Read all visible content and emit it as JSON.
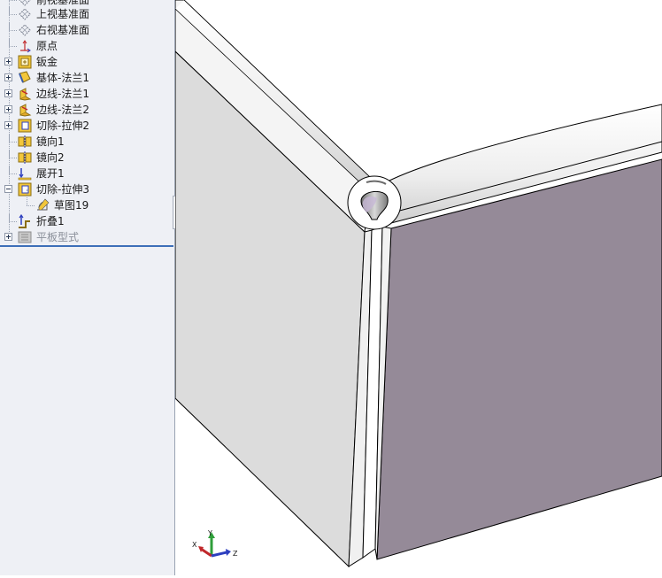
{
  "feature_tree": {
    "items": [
      {
        "label": "前视基准面",
        "icon": "plane-icon"
      },
      {
        "label": "上视基准面",
        "icon": "plane-icon"
      },
      {
        "label": "右视基准面",
        "icon": "plane-icon"
      },
      {
        "label": "原点",
        "icon": "origin-icon"
      },
      {
        "label": "钣金",
        "icon": "sheet-metal-icon"
      },
      {
        "label": "基体-法兰1",
        "icon": "base-flange-icon"
      },
      {
        "label": "边线-法兰1",
        "icon": "edge-flange-icon"
      },
      {
        "label": "边线-法兰2",
        "icon": "edge-flange-icon"
      },
      {
        "label": "切除-拉伸2",
        "icon": "cut-extrude-icon"
      },
      {
        "label": "镜向1",
        "icon": "mirror-icon"
      },
      {
        "label": "镜向2",
        "icon": "mirror-icon"
      },
      {
        "label": "展开1",
        "icon": "unfold-icon"
      },
      {
        "label": "切除-拉伸3",
        "icon": "cut-extrude-icon"
      },
      {
        "label": "草图19",
        "icon": "sketch-icon"
      },
      {
        "label": "折叠1",
        "icon": "fold-icon"
      },
      {
        "label": "平板型式",
        "icon": "flat-pattern-icon"
      }
    ]
  },
  "viewport": {
    "face_colors": {
      "left_panel": "#dcdcdc",
      "right_panel": "#958a98",
      "top_edge": "#f4f4f4",
      "outline": "#000000"
    }
  },
  "triad": {
    "x_label": "X",
    "y_label": "Y",
    "z_label": "Z",
    "colors": {
      "x": "#c0282b",
      "y": "#2f9e3a",
      "z": "#2d3fbf"
    }
  }
}
